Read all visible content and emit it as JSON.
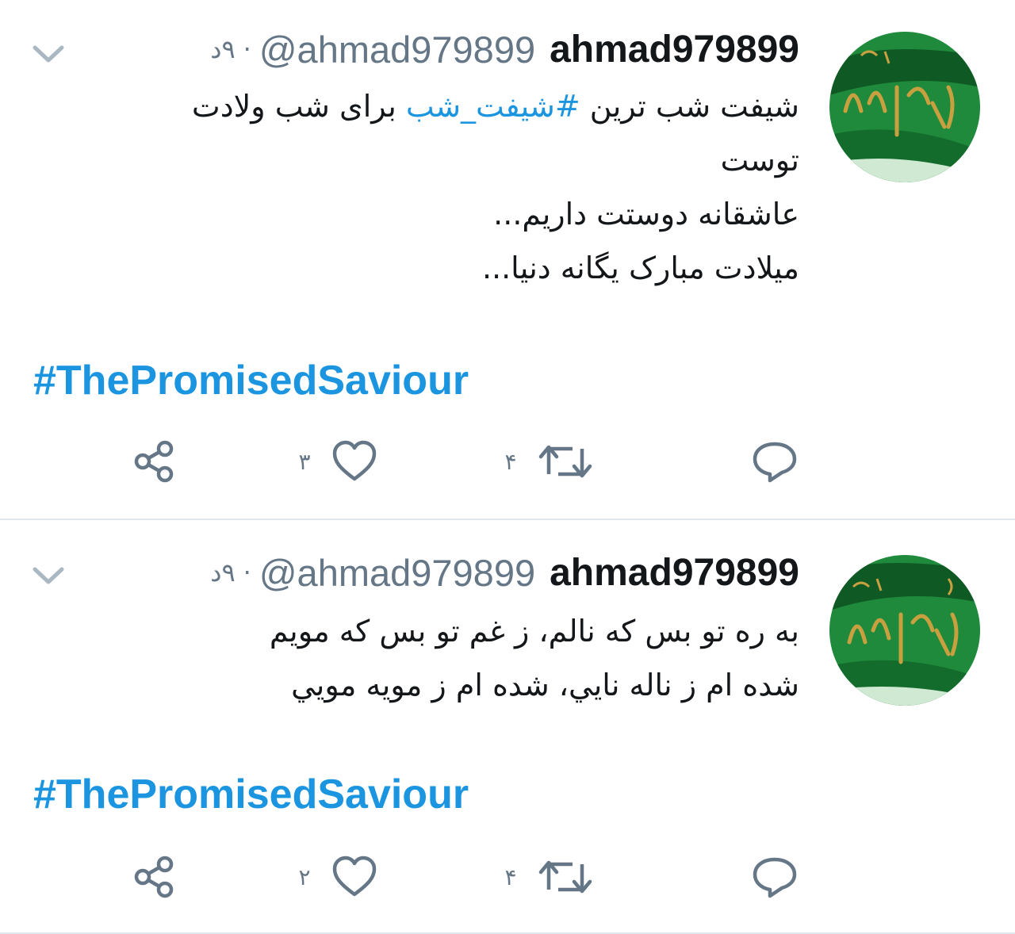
{
  "tweets": [
    {
      "display_name": "ahmad979899",
      "handle": "@ahmad979899",
      "separator": "·",
      "time": "۹د",
      "avatar_colors": {
        "base": "#1f8a3b",
        "dark": "#0f5a24",
        "gold": "#c8a040"
      },
      "body_lines": {
        "line1_after": "شیفت شب ترین ",
        "line1_hashtag": "#شیفت_شب",
        "line1_before": " برای شب ولادت",
        "line2": "توست",
        "line3": "عاشقانه دوستت داریم...",
        "line4": "میلادت مبارک یگانه دنیا..."
      },
      "hashtag_en": "#ThePromisedSaviour",
      "actions": {
        "reply_icon": "reply-icon",
        "retweet_icon": "retweet-icon",
        "retweet_count": "۴",
        "like_icon": "heart-icon",
        "like_count": "۳",
        "share_icon": "share-icon"
      }
    },
    {
      "display_name": "ahmad979899",
      "handle": "@ahmad979899",
      "separator": "·",
      "time": "۹د",
      "avatar_colors": {
        "base": "#1f8a3b",
        "dark": "#0f5a24",
        "gold": "#c8a040"
      },
      "body_lines": {
        "line1": "به ره تو بس که نالم، ز غم تو بس که مویم",
        "line2": "شده ام ز ناله نايي، شده ام ز مويه مويي"
      },
      "hashtag_en": "#ThePromisedSaviour",
      "actions": {
        "reply_icon": "reply-icon",
        "retweet_icon": "retweet-icon",
        "retweet_count": "۴",
        "like_icon": "heart-icon",
        "like_count": "۲",
        "share_icon": "share-icon"
      }
    }
  ],
  "colors": {
    "accent": "#1b95e0",
    "muted": "#657786",
    "text": "#14171a",
    "divider": "#e1e8ed"
  }
}
